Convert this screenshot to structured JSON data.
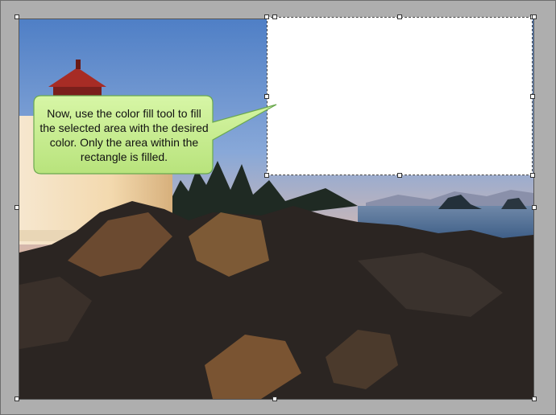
{
  "callout": {
    "text": "Now, use the color fill tool to fill the selected area with the desired color. Only the area within the rectangle is filled."
  },
  "colors": {
    "callout_fill": "#c4ec8c",
    "callout_border": "#6aa84f",
    "selection_fill": "#ffffff",
    "workspace": "#aeaeae"
  },
  "icons": {
    "selection": "selection-rectangle",
    "canvas_handles": "resize-handle"
  }
}
